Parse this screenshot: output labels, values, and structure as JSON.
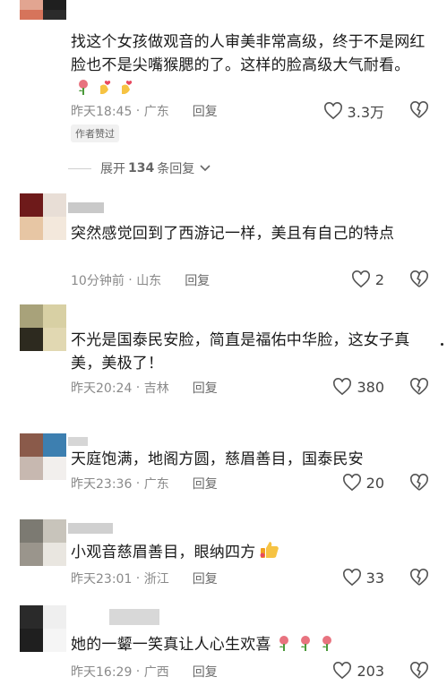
{
  "comments": [
    {
      "text": "找这个女孩做观音的人审美非常高级，终于不是网红脸也不是尖嘴猴腮的了。这样的脸高级大气耐看。",
      "emoji": [
        "rose",
        "hand-heart",
        "hand-heart"
      ],
      "time": "昨天18:45",
      "location": "广东",
      "reply": "回复",
      "likes": "3.3万",
      "author_tag": "作者赞过"
    },
    {
      "text": "突然感觉回到了西游记一样，美且有自己的特点",
      "time": "10分钟前",
      "location": "山东",
      "reply": "回复",
      "likes": "2"
    },
    {
      "text": "不光是国泰民安脸，简直是福佑中华脸，这女子真美，美极了！",
      "time": "昨天20:24",
      "location": "吉林",
      "reply": "回复",
      "likes": "380"
    },
    {
      "text": "天庭饱满，地阁方圆，慈眉善目，国泰民安",
      "time": "昨天23:36",
      "location": "广东",
      "reply": "回复",
      "likes": "20"
    },
    {
      "text": "小观音慈眉善目，眼纳四方",
      "emoji": [
        "thumbs-up"
      ],
      "time": "昨天23:01",
      "location": "浙江",
      "reply": "回复",
      "likes": "33"
    },
    {
      "text": "她的一颦一笑真让人心生欢喜",
      "emoji": [
        "rose",
        "rose",
        "rose"
      ],
      "time": "昨天16:29",
      "location": "广西",
      "reply": "回复",
      "likes": "203"
    }
  ],
  "expand_replies": {
    "prefix": "展开",
    "count": "134",
    "suffix": "条回复"
  },
  "colors": {
    "meta": "#8a8a8a",
    "text": "#1a1a1a",
    "rose": "#e8737f",
    "hand": "#f6c343"
  }
}
